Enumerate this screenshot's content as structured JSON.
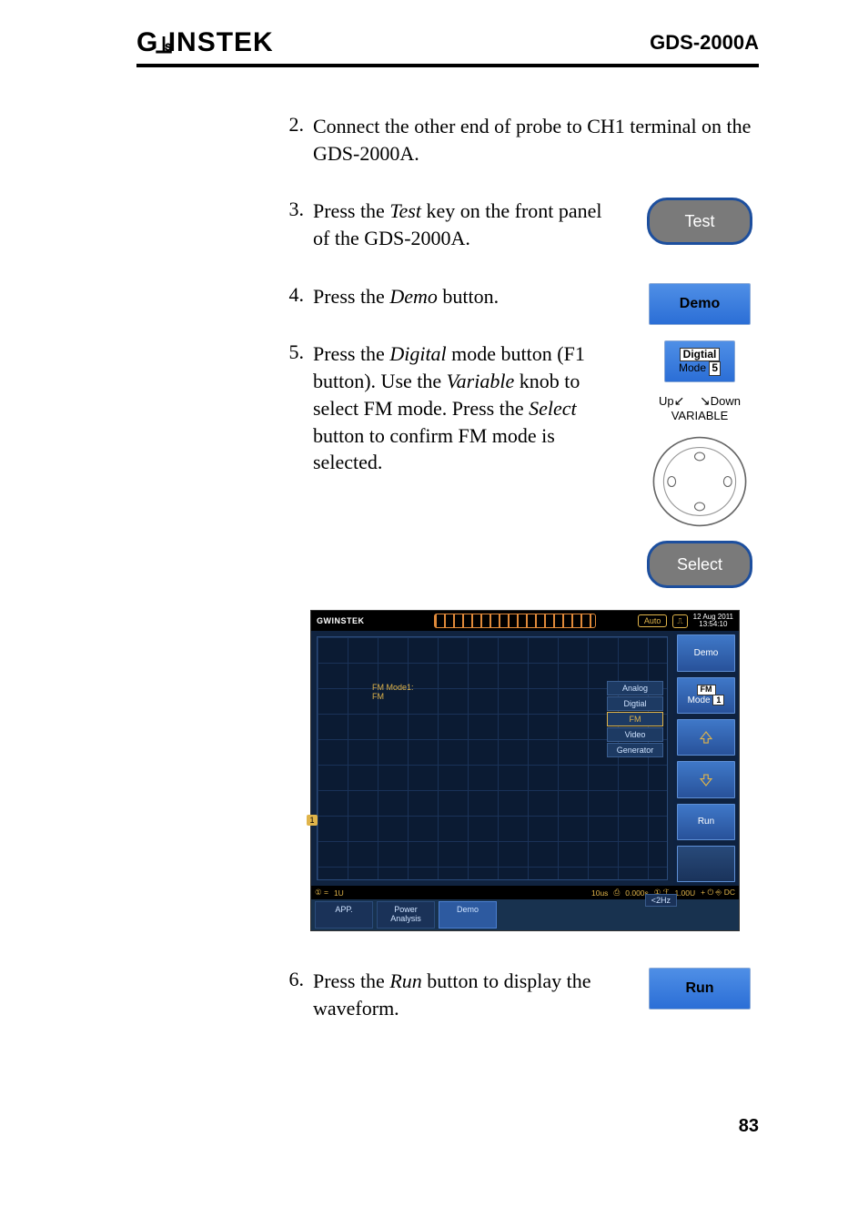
{
  "header": {
    "brand": "GWINSTEK",
    "model": "GDS-2000A"
  },
  "steps": [
    {
      "num": "2.",
      "text": "Connect the other end of probe to CH1 terminal on the GDS-2000A."
    },
    {
      "num": "3.",
      "text_pre": "Press the ",
      "text_em": "Test",
      "text_post": " key on the front panel of the GDS-2000A.",
      "btn_label": "Test"
    },
    {
      "num": "4.",
      "text_pre": "Press the ",
      "text_em": "Demo",
      "text_post": " button.",
      "btn_label": "Demo"
    },
    {
      "num": "5.",
      "text_pre": "Press the ",
      "text_em1": "Digital",
      "text_mid1": " mode button (F1 button). Use the ",
      "text_em2": "Variable",
      "text_mid2": " knob to select FM mode. Press the ",
      "text_em3": "Select",
      "text_post": " button to confirm FM mode is selected.",
      "mode_top": "Digtial",
      "mode_bottom_pre": "Mode ",
      "mode_bottom_box": "5",
      "var_up": "Up",
      "var_down": "Down",
      "var_label": "VARIABLE",
      "select_label": "Select"
    },
    {
      "num": "6.",
      "text_pre": "Press the ",
      "text_em": "Run",
      "text_post": " button to display the waveform.",
      "btn_label": "Run"
    }
  ],
  "oscope": {
    "brand": "GWINSTEK",
    "auto": "Auto",
    "date": "12 Aug 2011\n13:54:10",
    "grid_label": "FM Mode1:\nFM",
    "ch_marker": "1",
    "menu_items": [
      "Analog",
      "Digtial",
      "FM",
      "Video",
      "Generator"
    ],
    "menu_hilite_index": 2,
    "side": {
      "demo": "Demo",
      "fm_top": "FM",
      "fm_mode_pre": "Mode ",
      "fm_mode_box": "1",
      "run": "Run"
    },
    "bottom": {
      "ch": "1",
      "scale": "1U",
      "time": "10us",
      "pos": "0.000s",
      "trig_ch": "1",
      "trig_v": "1.00U",
      "coupling": "DC",
      "freq": "<2Hz"
    },
    "tabs": [
      "APP.",
      "Power\nAnalysis",
      "Demo"
    ]
  },
  "page_number": "83"
}
